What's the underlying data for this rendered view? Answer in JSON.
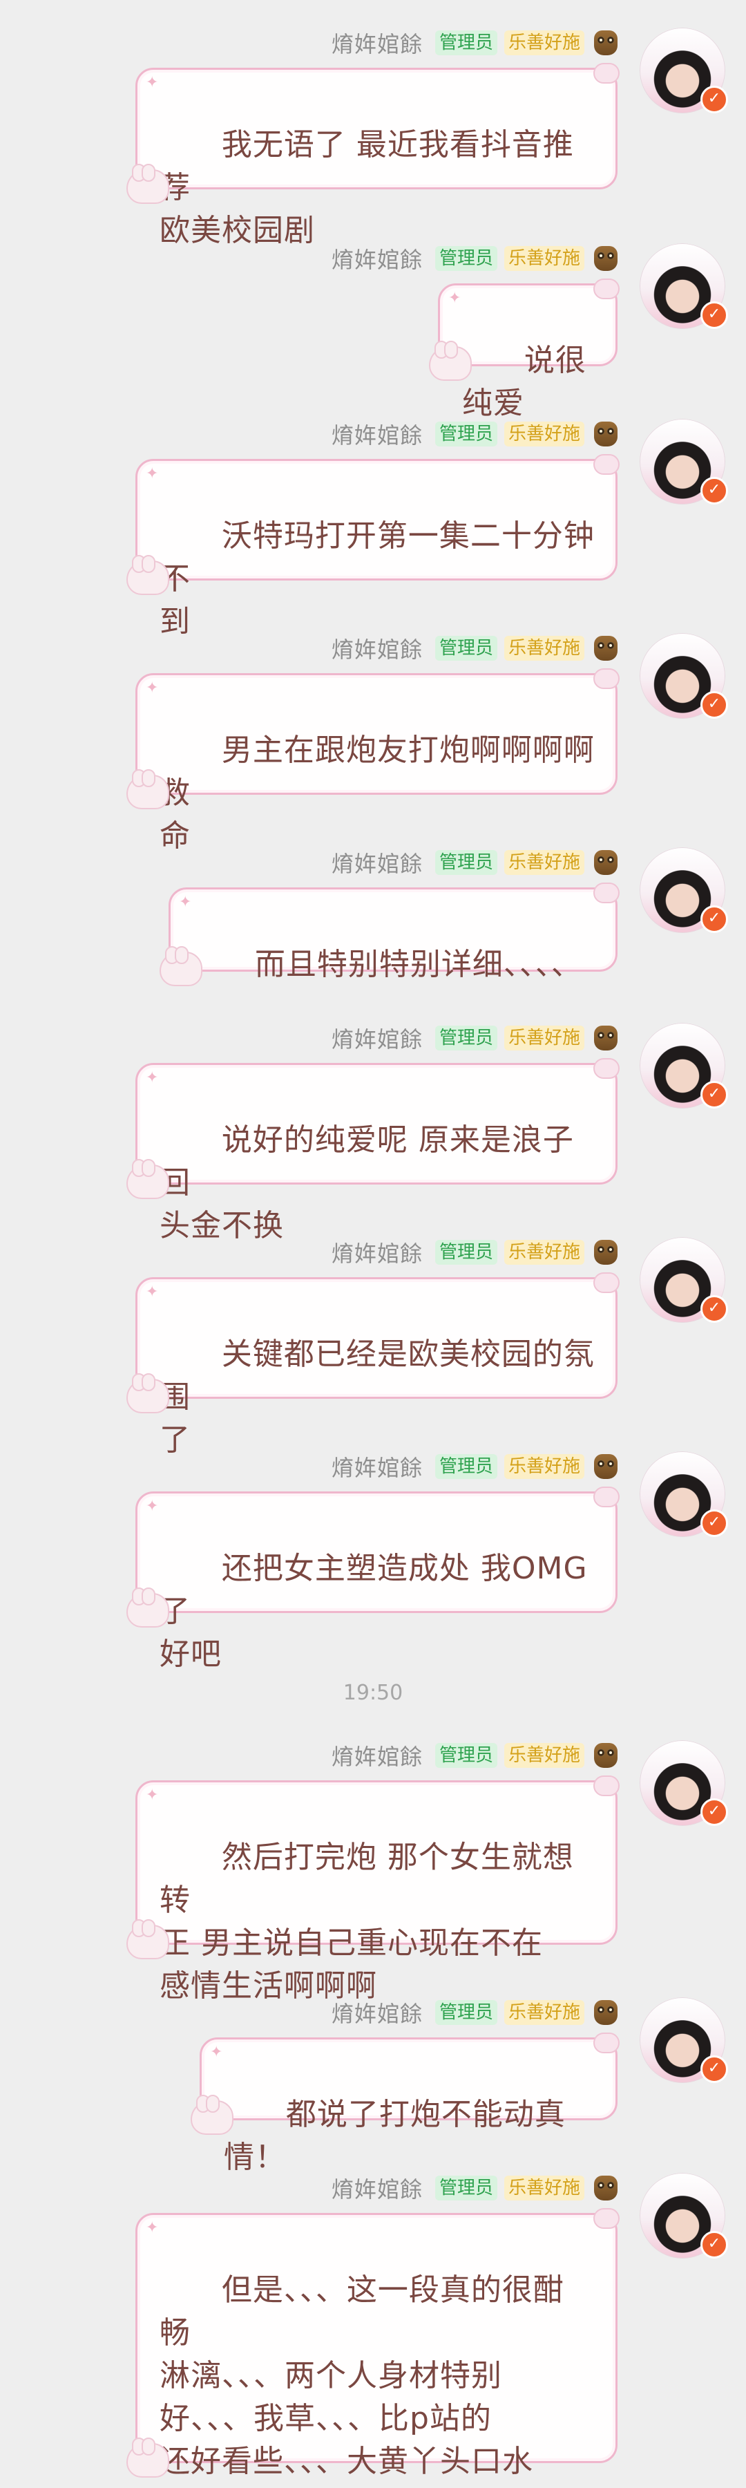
{
  "chat": {
    "sender_name": "焴姩婠餘",
    "admin_tag": "管理员",
    "charity_tag": "乐善好施",
    "time_divider": "19:50",
    "messages": [
      {
        "text": "我无语了 最近我看抖音推荐\n欧美校园剧"
      },
      {
        "text": "说很纯爱"
      },
      {
        "text": "沃特玛打开第一集二十分钟不\n到"
      },
      {
        "text": "男主在跟炮友打炮啊啊啊啊救\n命"
      },
      {
        "text": "而且特别特别详细、、、、"
      },
      {
        "text": "说好的纯爱呢 原来是浪子回\n头金不换"
      },
      {
        "text": "关键都已经是欧美校园的氛围\n了"
      },
      {
        "text": "还把女主塑造成处 我OMG了\n好吧"
      },
      {
        "text": "然后打完炮 那个女生就想转\n正 男主说自己重心现在不在\n感情生活啊啊啊"
      },
      {
        "text": "都说了打炮不能动真情！"
      },
      {
        "text": "但是、、、这一段真的很酣畅\n淋漓、、、两个人身材特别\n好、、、我草、、、比p站的\n还好看些、、、大黄丫头口水\n流出来了呀！！！"
      }
    ],
    "verify_badge_symbol": "✓",
    "colors": {
      "background": "#eeeeee",
      "bubble_border": "#efb6cc",
      "message_text": "#7a4741",
      "admin_tag_bg": "#d9f3df",
      "admin_tag_fg": "#2fa24f",
      "charity_tag_bg": "#fcefc6",
      "charity_tag_fg": "#d4a11a",
      "verify_badge": "#ef5f2b"
    }
  }
}
